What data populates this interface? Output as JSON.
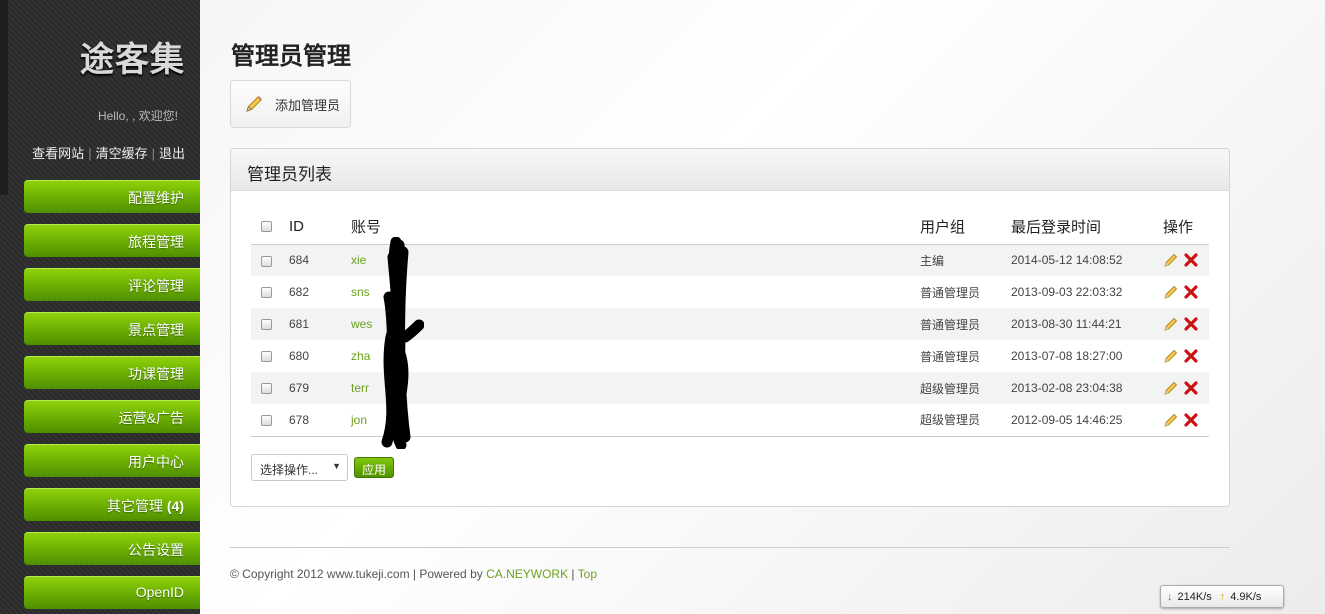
{
  "sidebar": {
    "logo": "途客集",
    "hello": "Hello, , 欢迎您!",
    "links": [
      "查看网站",
      "清空缓存",
      "退出"
    ],
    "nav": [
      "配置维护",
      "旅程管理",
      "评论管理",
      "景点管理",
      "功课管理",
      "运营&广告",
      "用户中心",
      "其它管理",
      "公告设置",
      "OpenID"
    ],
    "nav_badge": "(4)"
  },
  "main": {
    "title": "管理员管理",
    "add_button": "添加管理员",
    "panel_title": "管理员列表"
  },
  "table": {
    "headers": [
      "ID",
      "账号",
      "用户组",
      "最后登录时间",
      "操作"
    ],
    "rows": [
      {
        "id": "684",
        "account": "xie",
        "group": "主编",
        "time": "2014-05-12 14:08:52"
      },
      {
        "id": "682",
        "account": "sns",
        "group": "普通管理员",
        "time": "2013-09-03 22:03:32"
      },
      {
        "id": "681",
        "account": "wes",
        "group": "普通管理员",
        "time": "2013-08-30 11:44:21"
      },
      {
        "id": "680",
        "account": "zha",
        "group": "普通管理员",
        "time": "2013-07-08 18:27:00"
      },
      {
        "id": "679",
        "account": "terr",
        "group": "超级管理员",
        "time": "2013-02-08 23:04:38"
      },
      {
        "id": "678",
        "account": "jon",
        "group": "超级管理员",
        "time": "2012-09-05 14:46:25"
      }
    ]
  },
  "bulk": {
    "select_value": "选择操作...",
    "apply_label": "应用"
  },
  "footer": {
    "copyright": "© Copyright 2012 www.tukeji.com | Powered by ",
    "powered": "CA.NEYWORK",
    "sep": " | ",
    "top": "Top"
  },
  "netmon": {
    "down": "214K/s",
    "up": "4.9K/s"
  },
  "colors": {
    "accent_green": "#6db003",
    "link_green": "#6ca21e",
    "delete_red": "#cc1111"
  }
}
